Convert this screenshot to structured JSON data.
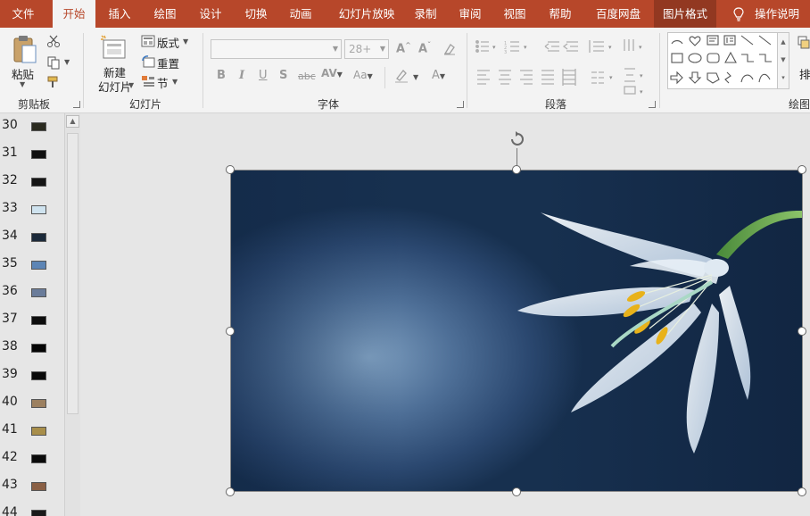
{
  "tabs": [
    {
      "label": "文件"
    },
    {
      "label": "开始"
    },
    {
      "label": "插入"
    },
    {
      "label": "绘图"
    },
    {
      "label": "设计"
    },
    {
      "label": "切换"
    },
    {
      "label": "动画"
    },
    {
      "label": "幻灯片放映"
    },
    {
      "label": "录制"
    },
    {
      "label": "审阅"
    },
    {
      "label": "视图"
    },
    {
      "label": "帮助"
    },
    {
      "label": "百度网盘"
    },
    {
      "label": "图片格式"
    }
  ],
  "tell_me": "操作说明搜",
  "clipboard": {
    "paste": "粘贴",
    "group": "剪贴板"
  },
  "slides_group": {
    "new_slide_line1": "新建",
    "new_slide_line2": "幻灯片",
    "layout": "版式",
    "reset": "重置",
    "section": "节",
    "group": "幻灯片"
  },
  "font_group": {
    "font_size": "28+",
    "group": "字体",
    "bold": "B",
    "italic": "I",
    "underline": "U",
    "shadow": "S",
    "strike": "abc"
  },
  "paragraph_group": {
    "group": "段落"
  },
  "drawing_group": {
    "group": "绘图",
    "arrange": "排"
  },
  "slide_numbers": [
    "30",
    "31",
    "32",
    "33",
    "34",
    "35",
    "36",
    "37",
    "38",
    "39",
    "40",
    "41",
    "42",
    "43",
    "44"
  ],
  "thumb_colors": [
    "#2b2b20",
    "#111111",
    "#151515",
    "#cfe3ef",
    "#1c2a3a",
    "#5d85b5",
    "#6a7c9a",
    "#0d0d0d",
    "#050505",
    "#0a0a0a",
    "#9c8060",
    "#a88e4a",
    "#0b0b0b",
    "#8a6045",
    "#1a1a1a"
  ],
  "colors": {
    "accent": "#b7472a",
    "context_tab": "#923821",
    "ribbon": "#f3f3f3"
  }
}
